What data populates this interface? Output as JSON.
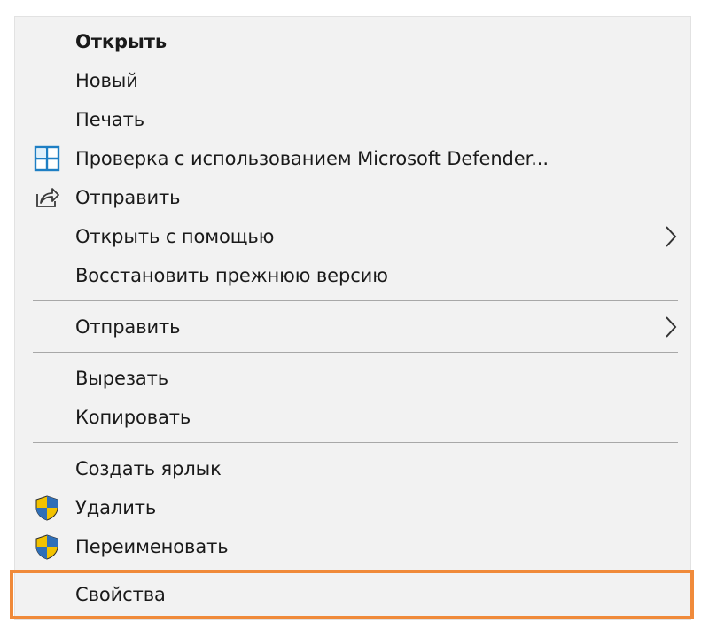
{
  "menu": {
    "items": [
      {
        "label": "Открыть"
      },
      {
        "label": "Новый"
      },
      {
        "label": "Печать"
      },
      {
        "label": "Проверка с использованием Microsoft Defender...",
        "icon": "defender-icon"
      },
      {
        "label": "Отправить",
        "icon": "share-icon"
      },
      {
        "label": "Открыть с помощью",
        "submenu": true
      },
      {
        "label": "Восстановить прежнюю версию"
      },
      {
        "label": "Отправить",
        "submenu": true
      },
      {
        "label": "Вырезать"
      },
      {
        "label": "Копировать"
      },
      {
        "label": "Создать ярлык"
      },
      {
        "label": "Удалить",
        "icon": "uac-shield-icon"
      },
      {
        "label": "Переименовать",
        "icon": "uac-shield-icon"
      },
      {
        "label": "Свойства",
        "highlighted": true
      }
    ]
  },
  "colors": {
    "menu_background": "#f2f2f2",
    "separator": "#a8a8a8",
    "highlight_border": "#f08a3a",
    "text": "#1a1a1a"
  }
}
